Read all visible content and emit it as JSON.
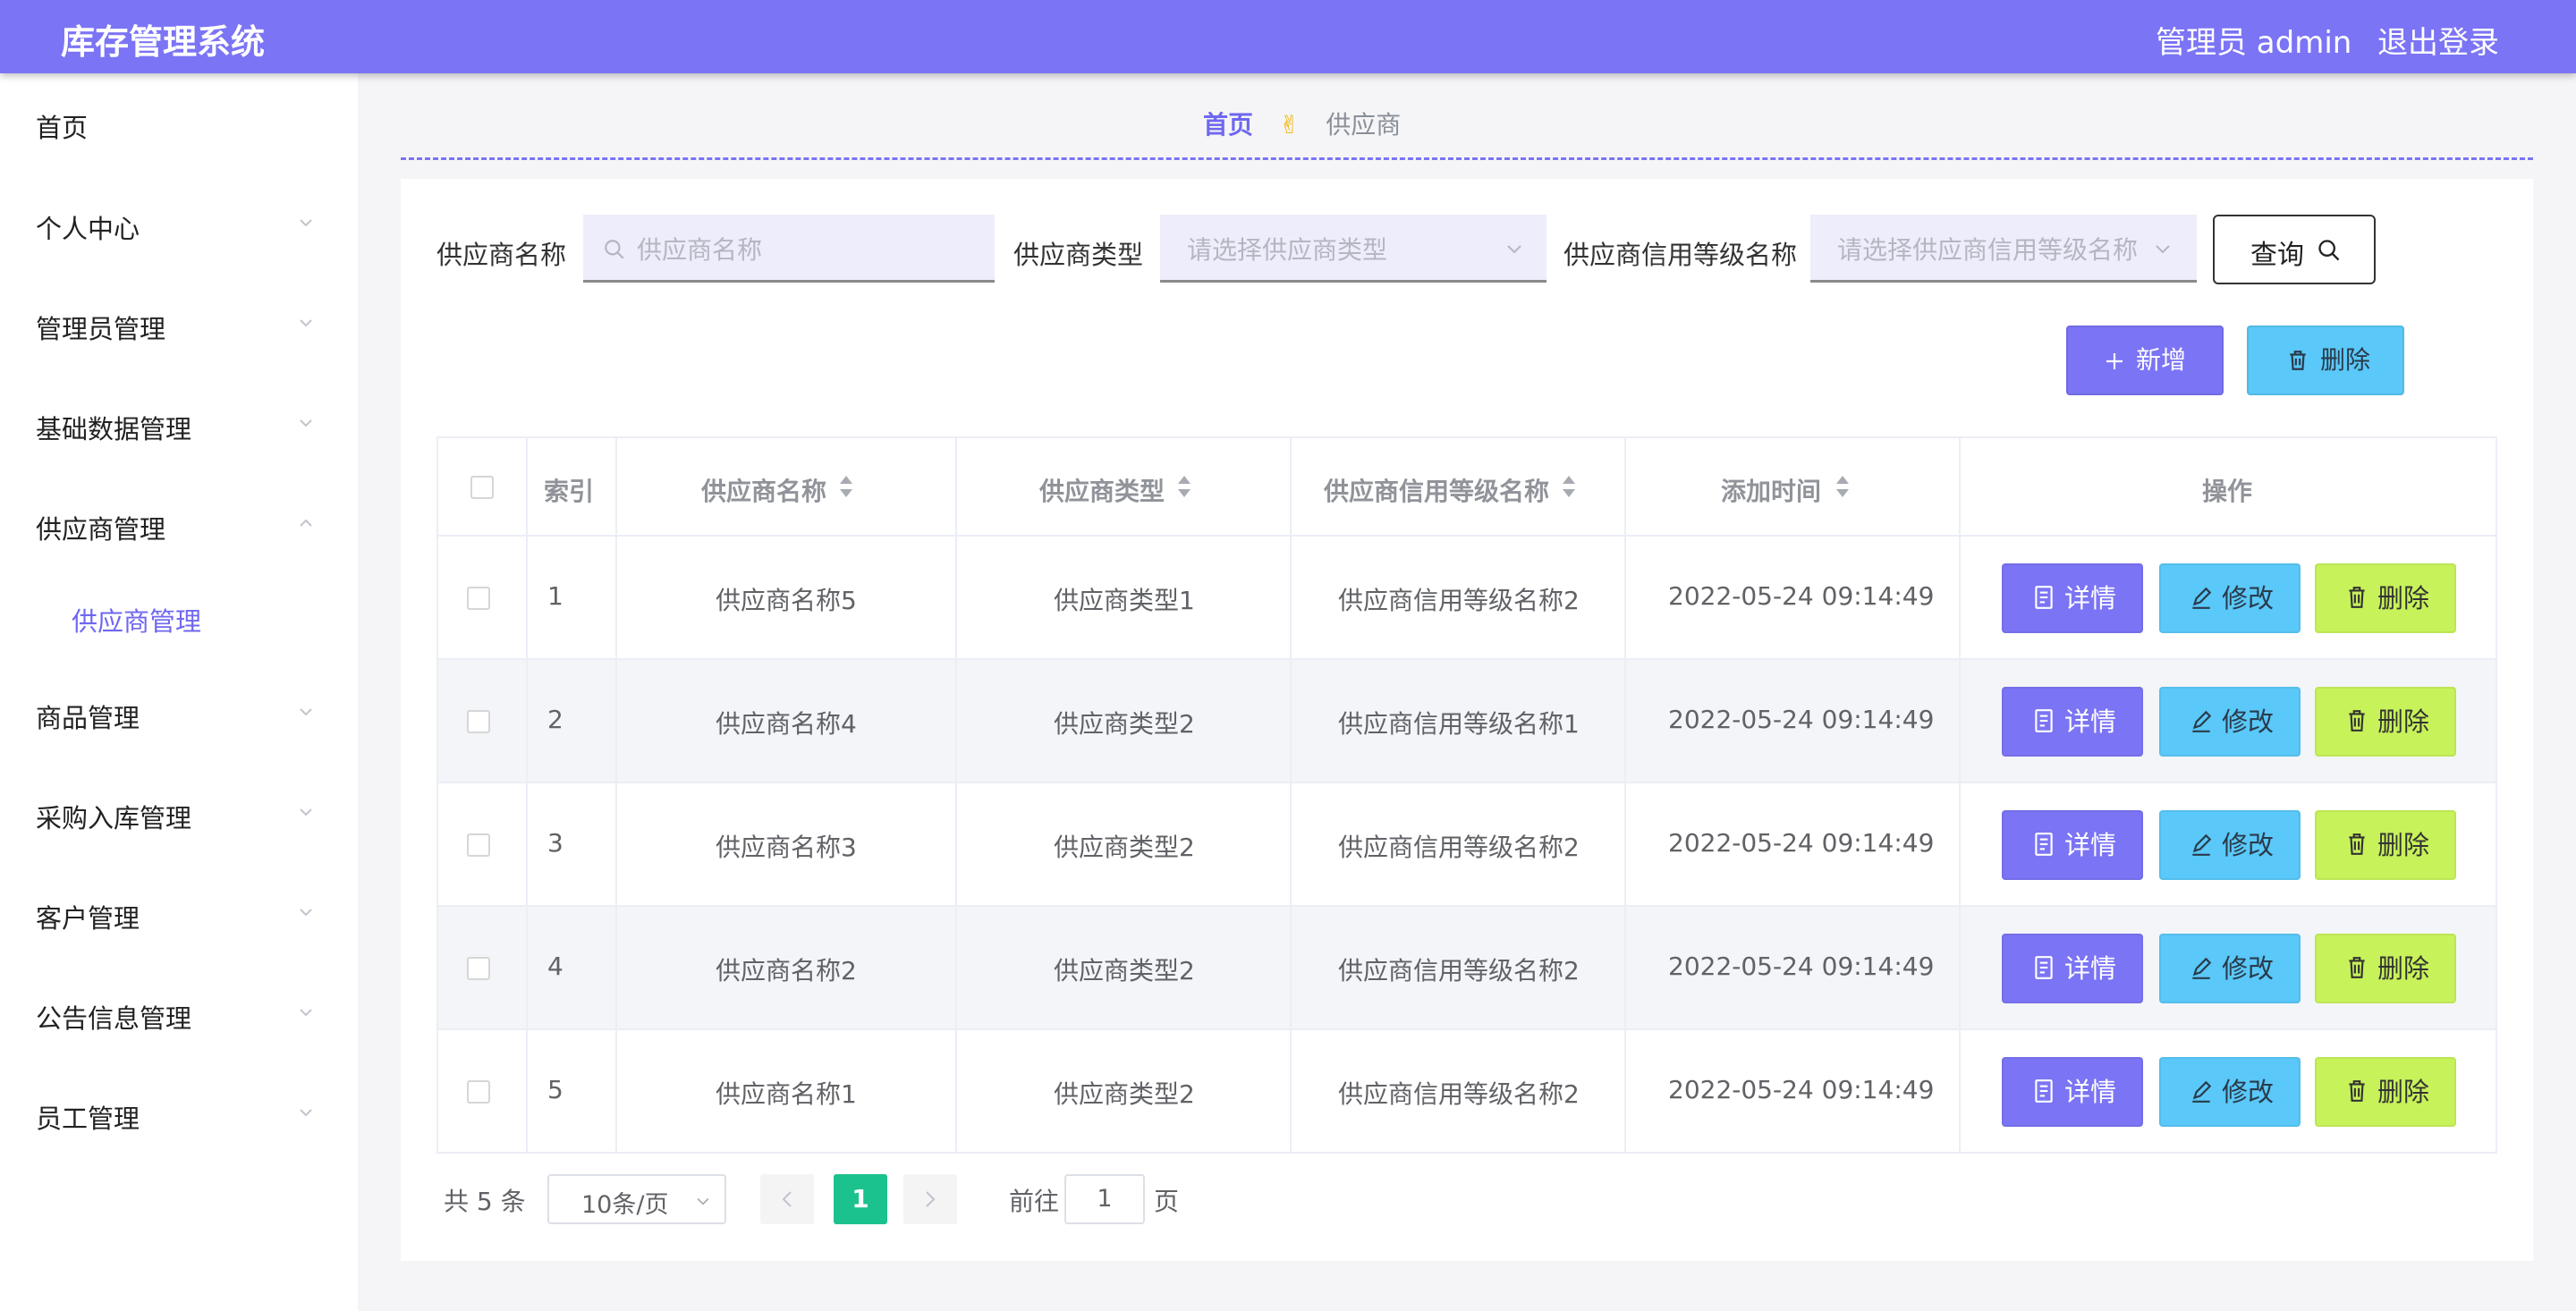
{
  "header": {
    "title": "库存管理系统",
    "user": "管理员 admin",
    "logout": "退出登录",
    "bg_color": "#7b74f5"
  },
  "sidebar": {
    "items": [
      {
        "label": "首页",
        "has_children": false
      },
      {
        "label": "个人中心",
        "has_children": true
      },
      {
        "label": "管理员管理",
        "has_children": true
      },
      {
        "label": "基础数据管理",
        "has_children": true
      },
      {
        "label": "供应商管理",
        "has_children": true,
        "expanded": true
      },
      {
        "label": "商品管理",
        "has_children": true
      },
      {
        "label": "采购入库管理",
        "has_children": true
      },
      {
        "label": "客户管理",
        "has_children": true
      },
      {
        "label": "公告信息管理",
        "has_children": true
      },
      {
        "label": "员工管理",
        "has_children": true
      }
    ],
    "subitem": {
      "label": "供应商管理",
      "active": true
    }
  },
  "breadcrumb": {
    "home": "首页",
    "separator": "✌",
    "current": "供应商"
  },
  "search": {
    "name_label": "供应商名称",
    "name_placeholder": "供应商名称",
    "type_label": "供应商类型",
    "type_placeholder": "请选择供应商类型",
    "credit_label": "供应商信用等级名称",
    "credit_placeholder": "请选择供应商信用等级名称",
    "query_button": "查询"
  },
  "toolbar": {
    "add_label": "新增",
    "delete_label": "删除"
  },
  "table": {
    "headers": {
      "index": "索引",
      "name": "供应商名称",
      "type": "供应商类型",
      "credit": "供应商信用等级名称",
      "time": "添加时间",
      "actions": "操作"
    },
    "rows": [
      {
        "index": "1",
        "name": "供应商名称5",
        "type": "供应商类型1",
        "credit": "供应商信用等级名称2",
        "time": "2022-05-24 09:14:49"
      },
      {
        "index": "2",
        "name": "供应商名称4",
        "type": "供应商类型2",
        "credit": "供应商信用等级名称1",
        "time": "2022-05-24 09:14:49"
      },
      {
        "index": "3",
        "name": "供应商名称3",
        "type": "供应商类型2",
        "credit": "供应商信用等级名称2",
        "time": "2022-05-24 09:14:49"
      },
      {
        "index": "4",
        "name": "供应商名称2",
        "type": "供应商类型2",
        "credit": "供应商信用等级名称2",
        "time": "2022-05-24 09:14:49"
      },
      {
        "index": "5",
        "name": "供应商名称1",
        "type": "供应商类型2",
        "credit": "供应商信用等级名称2",
        "time": "2022-05-24 09:14:49"
      }
    ],
    "row_actions": {
      "detail": "详情",
      "edit": "修改",
      "delete": "删除"
    }
  },
  "pagination": {
    "total": "共 5 条",
    "page_size": "10条/页",
    "current": "1",
    "goto_label": "前往",
    "goto_value": "1",
    "page_unit": "页"
  },
  "colors": {
    "primary": "#7b74f5",
    "info": "#5ac8f8",
    "lime": "#c7f25a",
    "success": "#1cc28e"
  }
}
